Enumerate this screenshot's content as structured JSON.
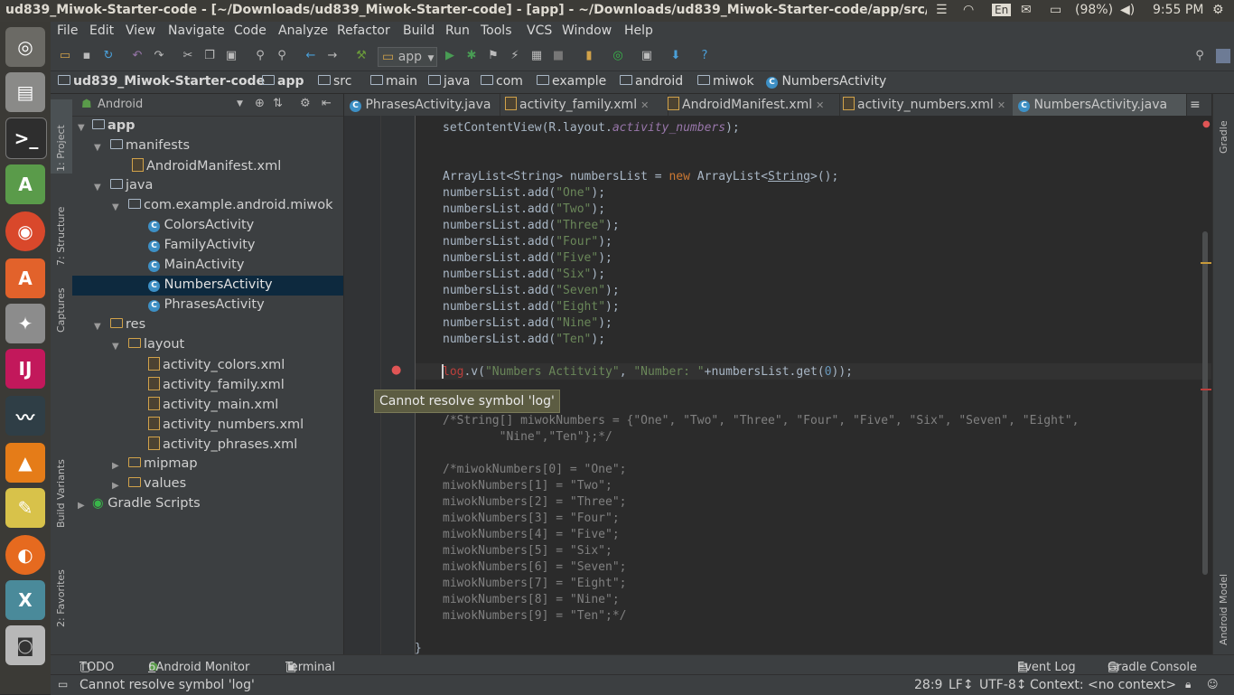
{
  "window_title": "ud839_Miwok-Starter-code - [~/Downloads/ud839_Miwok-Starter-code] - [app] - ~/Downloads/ud839_Miwok-Starter-code/app/src/main/java",
  "system": {
    "lang": "En",
    "battery": "(98%)",
    "time": "9:55 PM"
  },
  "menu": [
    "File",
    "Edit",
    "View",
    "Navigate",
    "Code",
    "Analyze",
    "Refactor",
    "Build",
    "Run",
    "Tools",
    "VCS",
    "Window",
    "Help"
  ],
  "toolbar": {
    "config": "app"
  },
  "breadcrumb": [
    "ud839_Miwok-Starter-code",
    "app",
    "src",
    "main",
    "java",
    "com",
    "example",
    "android",
    "miwok",
    "NumbersActivity"
  ],
  "project": {
    "view_mode": "Android",
    "tree": [
      {
        "label": "app",
        "level": 0,
        "type": "module",
        "expanded": true
      },
      {
        "label": "manifests",
        "level": 1,
        "type": "folder",
        "expanded": true
      },
      {
        "label": "AndroidManifest.xml",
        "level": 2,
        "type": "xml"
      },
      {
        "label": "java",
        "level": 1,
        "type": "folder",
        "expanded": true
      },
      {
        "label": "com.example.android.miwok",
        "level": 2,
        "type": "package",
        "expanded": true
      },
      {
        "label": "ColorsActivity",
        "level": 3,
        "type": "class"
      },
      {
        "label": "FamilyActivity",
        "level": 3,
        "type": "class"
      },
      {
        "label": "MainActivity",
        "level": 3,
        "type": "class"
      },
      {
        "label": "NumbersActivity",
        "level": 3,
        "type": "class",
        "selected": true
      },
      {
        "label": "PhrasesActivity",
        "level": 3,
        "type": "class"
      },
      {
        "label": "res",
        "level": 1,
        "type": "folder",
        "expanded": true
      },
      {
        "label": "layout",
        "level": 2,
        "type": "folder",
        "expanded": true
      },
      {
        "label": "activity_colors.xml",
        "level": 3,
        "type": "xml"
      },
      {
        "label": "activity_family.xml",
        "level": 3,
        "type": "xml"
      },
      {
        "label": "activity_main.xml",
        "level": 3,
        "type": "xml"
      },
      {
        "label": "activity_numbers.xml",
        "level": 3,
        "type": "xml"
      },
      {
        "label": "activity_phrases.xml",
        "level": 3,
        "type": "xml"
      },
      {
        "label": "mipmap",
        "level": 2,
        "type": "folder",
        "expanded": false
      },
      {
        "label": "values",
        "level": 2,
        "type": "folder",
        "expanded": false
      },
      {
        "label": "Gradle Scripts",
        "level": 0,
        "type": "gradle",
        "expanded": false
      }
    ]
  },
  "left_tools": [
    "1: Project",
    "7: Structure",
    "Captures",
    "Build Variants",
    "2: Favorites"
  ],
  "right_tools": [
    "Gradle",
    "Android Model"
  ],
  "tabs": [
    {
      "label": "PhrasesActivity.java"
    },
    {
      "label": "activity_family.xml"
    },
    {
      "label": "AndroidManifest.xml"
    },
    {
      "label": "activity_numbers.xml"
    },
    {
      "label": "NumbersActivity.java",
      "active": true
    }
  ],
  "tab_overflow": "≡",
  "code": {
    "set_content": "setContentView(R.layout.",
    "set_content_field": "activity_numbers",
    "set_content_end": ");",
    "list_decl_a": "ArrayList<String> numbersList = ",
    "list_decl_new": "new",
    "list_decl_b": " ArrayList<",
    "list_decl_type": "String",
    "list_decl_c": ">();",
    "add_prefix": "numbersList.add(",
    "add_suffix": ");",
    "numbers": [
      "\"One\"",
      "\"Two\"",
      "\"Three\"",
      "\"Four\"",
      "\"Five\"",
      "\"Six\"",
      "\"Seven\"",
      "\"Eight\"",
      "\"Nine\"",
      "\"Ten\""
    ],
    "log_err": "log",
    "log_a": ".v(",
    "log_tag": "\"Numbers Actitvity\"",
    "log_comma": ", ",
    "log_msg": "\"Number: \"",
    "log_b": "+numbersList.get(",
    "log_idx": "0",
    "log_c": "));",
    "comment1_l1": "/*String[] miwokNumbers = {\"One\", \"Two\", \"Three\", \"Four\", \"Five\", \"Six\", \"Seven\", \"Eight\",",
    "comment1_l2": "        \"Nine\",\"Ten\"};*/",
    "comment2": [
      "/*miwokNumbers[0] = \"One\";",
      "miwokNumbers[1] = \"Two\";",
      "miwokNumbers[2] = \"Three\";",
      "miwokNumbers[3] = \"Four\";",
      "miwokNumbers[4] = \"Five\";",
      "miwokNumbers[5] = \"Six\";",
      "miwokNumbers[6] = \"Seven\";",
      "miwokNumbers[7] = \"Eight\";",
      "miwokNumbers[8] = \"Nine\";",
      "miwokNumbers[9] = \"Ten\";*/"
    ],
    "closing_brace": "}"
  },
  "tooltip": "Cannot resolve symbol 'log'",
  "bottom_tools": {
    "todo": "TODO",
    "monitor_num": "6",
    "monitor": ": Android Monitor",
    "terminal": "Terminal",
    "event_log": "Event Log",
    "gradle_console": "Gradle Console"
  },
  "status": {
    "message": "Cannot resolve symbol 'log'",
    "position": "28:9",
    "line_sep": "LF↕",
    "encoding": "UTF-8↕",
    "context": "Context: <no context>"
  }
}
